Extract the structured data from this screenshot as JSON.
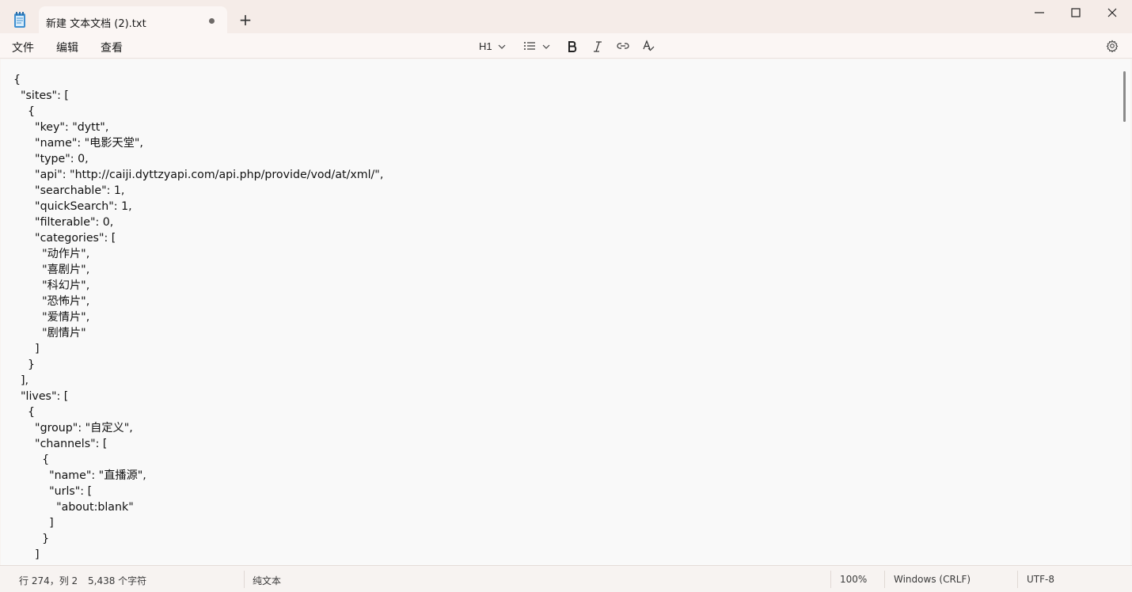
{
  "tab": {
    "title": "新建 文本文档 (2).txt",
    "new_tab_label": "+"
  },
  "menu": {
    "file": "文件",
    "edit": "编辑",
    "view": "查看"
  },
  "toolbar": {
    "heading": "H1"
  },
  "editor": {
    "lines": [
      "{",
      "  \"sites\": [",
      "    {",
      "      \"key\": \"dytt\",",
      "      \"name\": \"电影天堂\",",
      "      \"type\": 0,",
      "      \"api\": \"http://caiji.dyttzyapi.com/api.php/provide/vod/at/xml/\",",
      "      \"searchable\": 1,",
      "      \"quickSearch\": 1,",
      "      \"filterable\": 0,",
      "      \"categories\": [",
      "        \"动作片\",",
      "        \"喜剧片\",",
      "        \"科幻片\",",
      "        \"恐怖片\",",
      "        \"爱情片\",",
      "        \"剧情片\"",
      "      ]",
      "    }",
      "  ],",
      "  \"lives\": [",
      "    {",
      "      \"group\": \"自定义\",",
      "      \"channels\": [",
      "        {",
      "          \"name\": \"直播源\",",
      "          \"urls\": [",
      "            \"about:blank\"",
      "          ]",
      "        }",
      "      ]"
    ]
  },
  "status": {
    "position": "行 274，列 2",
    "char_count": "5,438 个字符",
    "format": "纯文本",
    "zoom": "100%",
    "line_ending": "Windows (CRLF)",
    "encoding": "UTF-8"
  }
}
